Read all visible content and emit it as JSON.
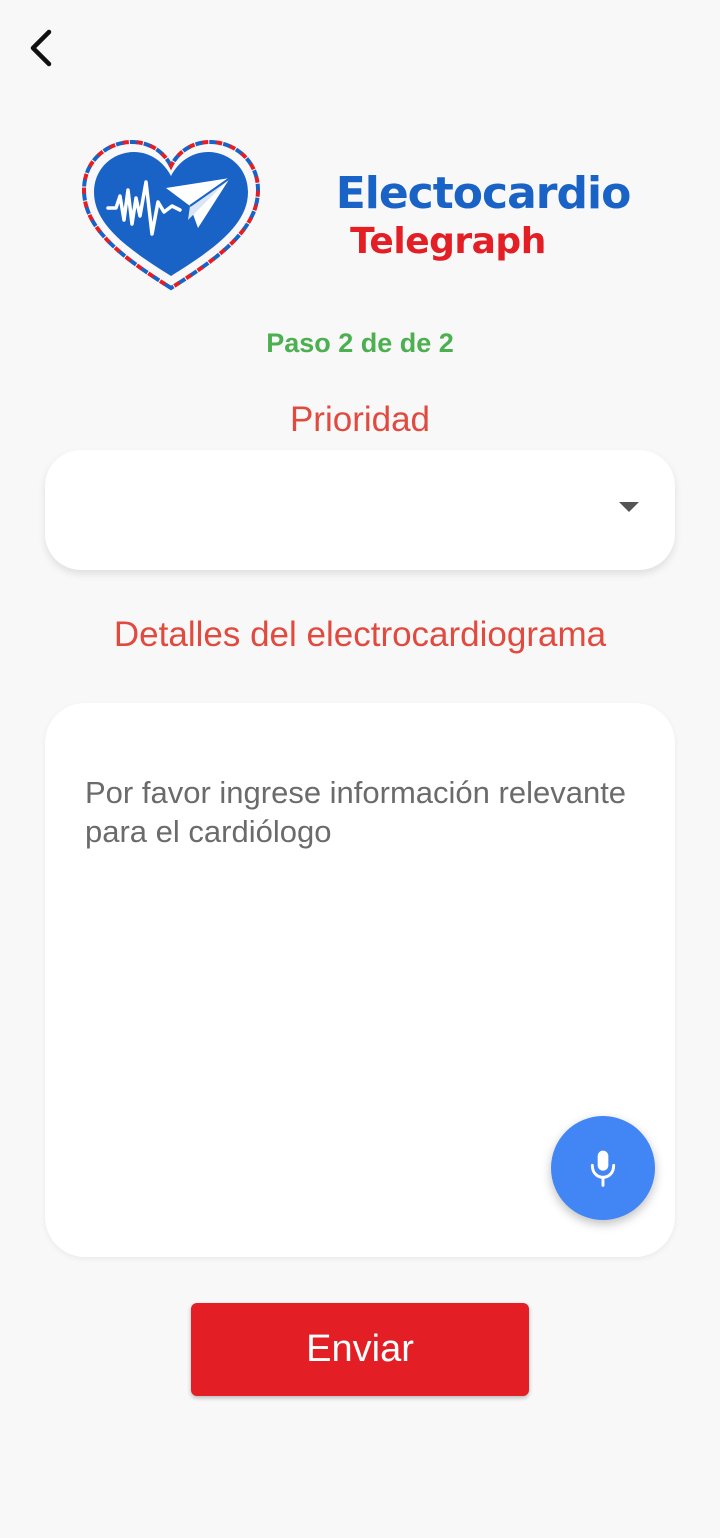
{
  "header": {
    "back_icon": "chevron-left-icon"
  },
  "brand": {
    "logo_icon": "heart-ecg-paper-plane-logo",
    "name_line1": "Electocardio",
    "name_line2": "Telegraph",
    "colors": {
      "primary": "#1a63c6",
      "secondary": "#e31e24"
    }
  },
  "form": {
    "step_text": "Paso 2 de de 2",
    "priority_label": "Prioridad",
    "priority_value": "",
    "priority_dropdown_icon": "caret-down-icon",
    "details_label": "Detalles del electrocardiograma",
    "details_value": "",
    "details_placeholder": "Por favor ingrese información relevante para el cardiólogo",
    "mic_icon": "microphone-icon",
    "submit_label": "Enviar"
  },
  "colors": {
    "step": "#4caf50",
    "label": "#e04a3f",
    "mic_button": "#4285f4",
    "submit_button": "#e31e24",
    "background": "#f8f8f8"
  }
}
